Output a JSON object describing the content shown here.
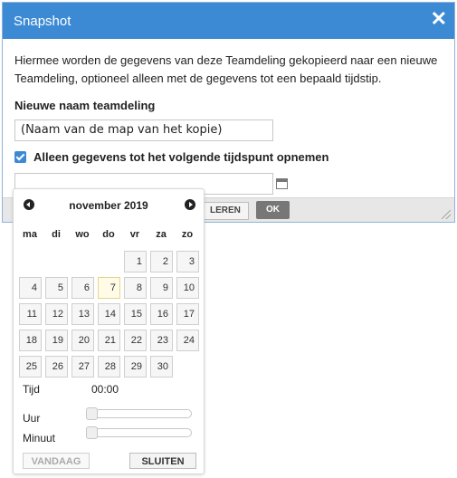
{
  "dialog": {
    "title": "Snapshot",
    "close_glyph": "✕",
    "description": "Hiermee worden de gegevens van deze Teamdeling gekopieerd naar een nieuwe Teamdeling, optioneel alleen met de gegevens tot een bepaald tijdstip.",
    "name_label": "Nieuwe naam teamdeling",
    "name_value": "(Naam van de map van het kopie)",
    "checkbox_label": "Alleen gegevens tot het volgende tijdspunt opnemen",
    "checkbox_checked": true,
    "date_value": "",
    "cancel_label": "LEREN",
    "ok_label": "OK",
    "accent_color": "#3d8ad4"
  },
  "datepicker": {
    "month_label": "november 2019",
    "weekdays": [
      "ma",
      "di",
      "wo",
      "do",
      "vr",
      "za",
      "zo"
    ],
    "first_weekday_index": 4,
    "days_in_month": 30,
    "today": 7,
    "time_label": "Tijd",
    "time_value": "00:00",
    "hour_label": "Uur",
    "minute_label": "Minuut",
    "hour_value": 0,
    "minute_value": 0,
    "today_button": "VANDAAG",
    "close_button": "SLUITEN"
  }
}
